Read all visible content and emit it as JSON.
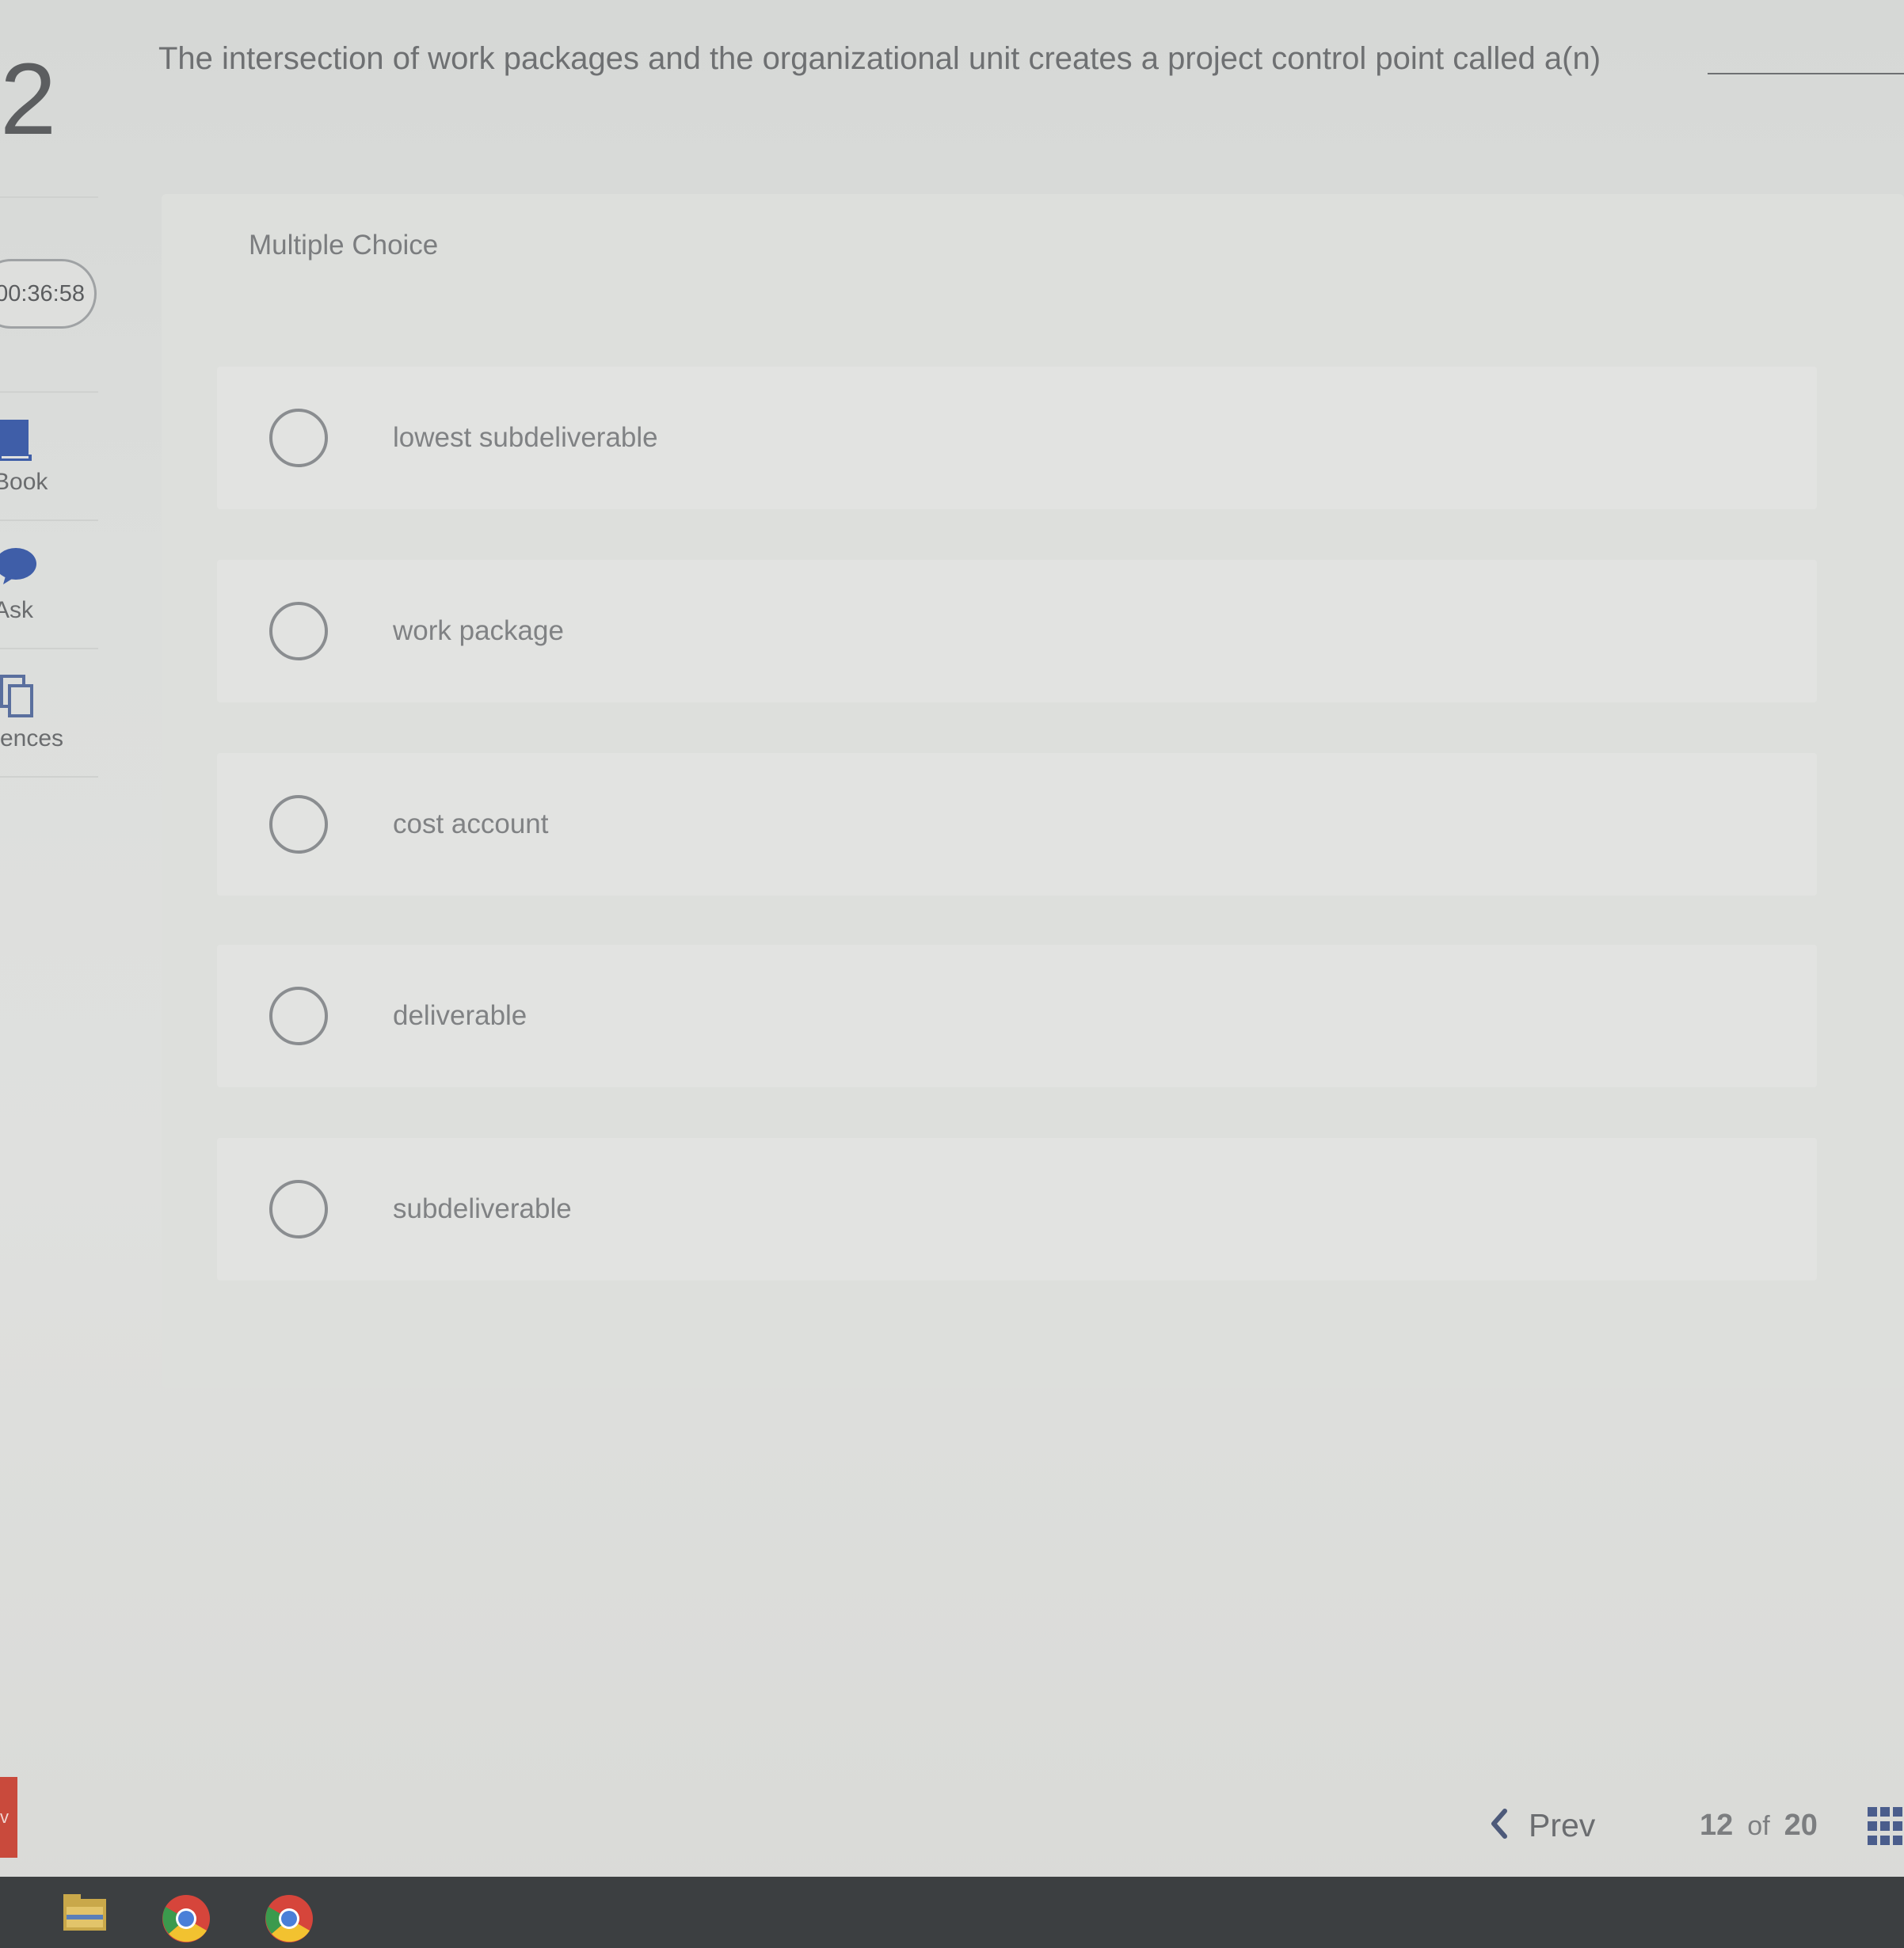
{
  "sidebar": {
    "question_number": "2",
    "timer": "00:36:58",
    "tools": [
      {
        "label": "Book",
        "icon": "book-icon"
      },
      {
        "label": "Ask",
        "icon": "speech-bubble-icon"
      },
      {
        "label": "rences",
        "icon": "copy-icon"
      }
    ],
    "red_tab_text": "v"
  },
  "question": {
    "text": "The intersection of work packages and the organizational unit creates a project control point called a(n)"
  },
  "choices_panel": {
    "label": "Multiple Choice",
    "options": [
      {
        "label": "lowest subdeliverable",
        "selected": false
      },
      {
        "label": "work package",
        "selected": false
      },
      {
        "label": "cost account",
        "selected": false
      },
      {
        "label": "deliverable",
        "selected": false
      },
      {
        "label": "subdeliverable",
        "selected": false
      }
    ]
  },
  "footer": {
    "prev_label": "Prev",
    "current_page": "12",
    "of_label": "of",
    "total_pages": "20"
  },
  "taskbar": {
    "icons": [
      "file-explorer-icon",
      "chrome-icon",
      "chrome-icon"
    ]
  },
  "colors": {
    "background": "#dcdedc",
    "panel": "#dddfdc",
    "choice_row": "#e2e3e1",
    "taskbar": "#3c3f41",
    "red_tab": "#c94a3c",
    "text": "#6e7072"
  }
}
